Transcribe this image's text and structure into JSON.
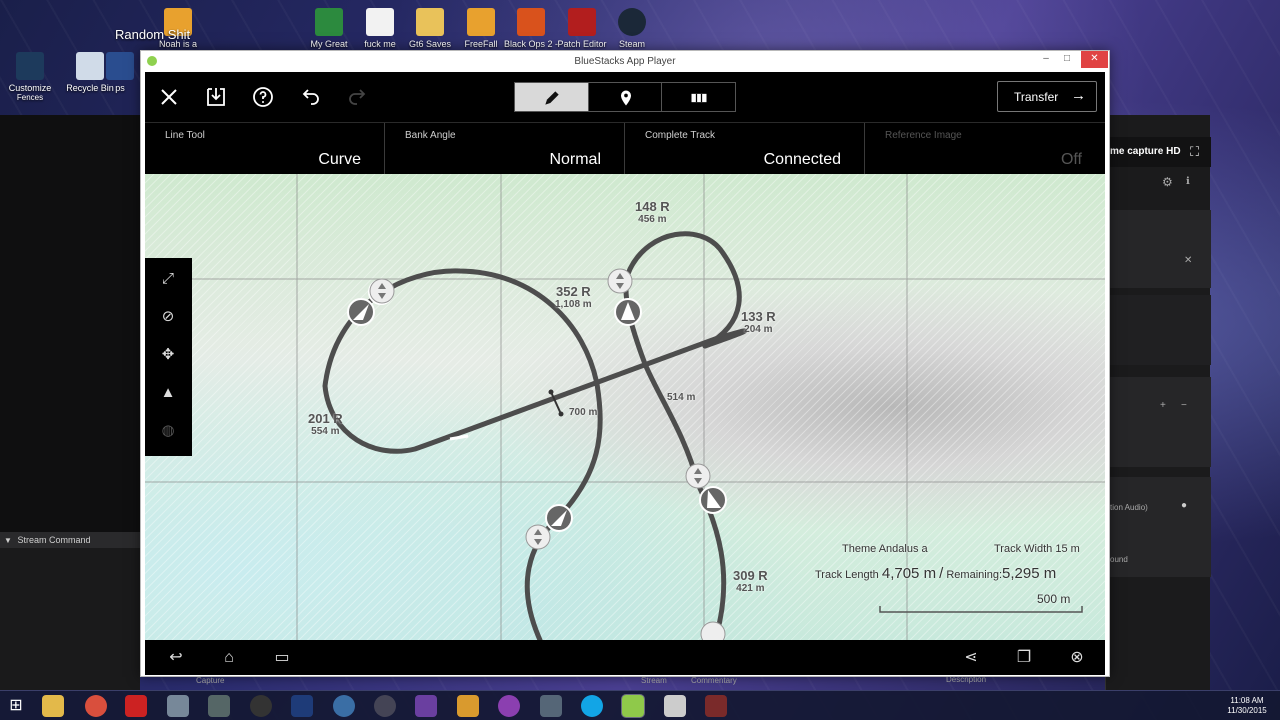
{
  "desktop": {
    "background_label": "Random Shit",
    "top_icons": [
      {
        "label": "Noah is a",
        "sub": ""
      },
      {
        "label": "My Great",
        "sub": ""
      },
      {
        "label": "fuck me",
        "sub": ""
      },
      {
        "label": "Gt6 Saves",
        "sub": ""
      },
      {
        "label": "FreeFall",
        "sub": ""
      },
      {
        "label": "Black Ops 2 -",
        "sub": ""
      },
      {
        "label": "Patch Editor",
        "sub": ""
      },
      {
        "label": "Steam",
        "sub": ""
      }
    ],
    "left_icons": [
      {
        "label": "Customize",
        "sub": "Fences"
      },
      {
        "label": "Recycle Bin",
        "sub": ""
      },
      {
        "label": "ps",
        "sub": ""
      }
    ]
  },
  "left_panel": {
    "title": "Stream Command"
  },
  "right_panel": {
    "title": "me capture HD",
    "audio_label": "tion Audio)",
    "sound_label": "ound"
  },
  "under_labels": [
    "Capture",
    "Stream",
    "Commentary",
    "Description"
  ],
  "window": {
    "title": "BlueStacks App Player",
    "controls": {
      "minimize": "–",
      "maximize": "□",
      "close": "✕"
    }
  },
  "toolbar": {
    "transfer_label": "Transfer",
    "transfer_arrow": "→"
  },
  "settings": [
    {
      "label": "Line Tool",
      "value": "Curve"
    },
    {
      "label": "Bank Angle",
      "value": "Normal"
    },
    {
      "label": "Complete Track",
      "value": "Connected"
    },
    {
      "label": "Reference Image",
      "value": "Off"
    }
  ],
  "track_labels": [
    {
      "radius": "148 R",
      "length": "456 m"
    },
    {
      "radius": "352 R",
      "length": "1,108 m"
    },
    {
      "radius": "133 R",
      "length": "204 m"
    },
    {
      "radius": "201 R",
      "length": "554 m"
    },
    {
      "radius": "",
      "length": "700 m"
    },
    {
      "radius": "",
      "length": "514 m"
    },
    {
      "radius": "309 R",
      "length": "421 m"
    }
  ],
  "info": {
    "theme_label": "Theme",
    "theme_value": "Andalus a",
    "width_label": "Track Width",
    "width_value": "15 m",
    "length_label": "Track Length",
    "length_value": "4,705 m",
    "separator": "/",
    "remaining_label": "Remaining:",
    "remaining_value": "5,295 m",
    "scale_label": "500 m"
  },
  "taskbar": {
    "time": "11:08 AM",
    "date": "11/30/2015"
  },
  "colors": {
    "track": "#4d4d4d",
    "map_green": "#cfe9cf",
    "map_teal": "#c8e9dc",
    "active_segment": "#d9d9d9",
    "window_close": "#e04343"
  }
}
